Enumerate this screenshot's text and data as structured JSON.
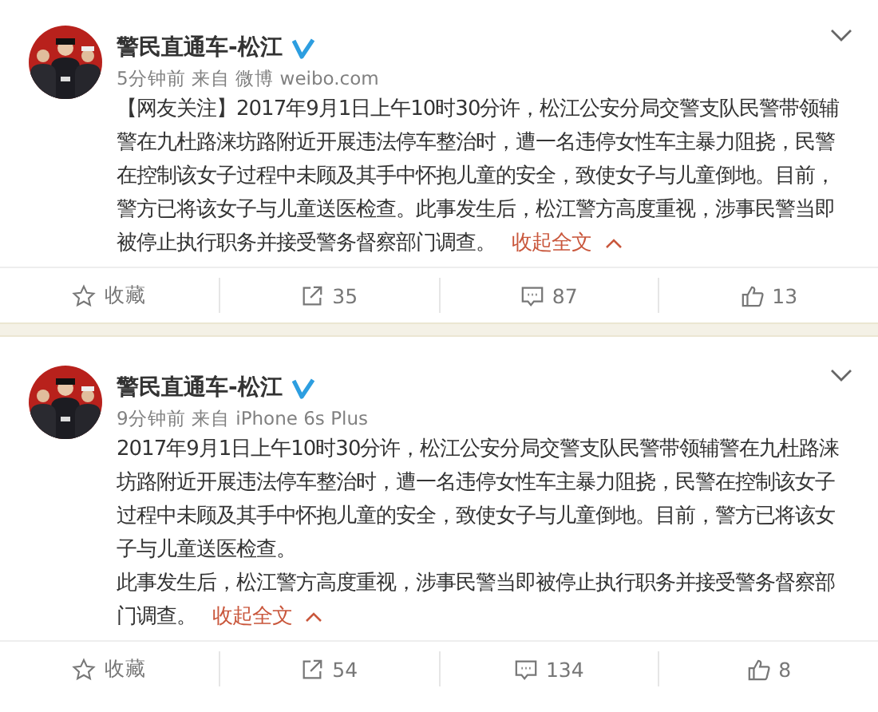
{
  "posts": [
    {
      "author": "警民直通车-松江",
      "verified": true,
      "meta": "5分钟前 来自 微博 weibo.com",
      "paragraphs": [
        "【网友关注】2017年9月1日上午10时30分许，松江公安分局交警支队民警带领辅警在九杜路涞坊路附近开展违法停车整治时，遭一名违停女性车主暴力阻挠，民警在控制该女子过程中未顾及其手中怀抱儿童的安全，致使女子与儿童倒地。目前，警方已将该女子与儿童送医检查。此事发生后，松江警方高度重视，涉事民警当即被停止执行职务并接受警务督察部门调查。"
      ],
      "collapse_link": "收起全文",
      "actions": [
        {
          "kind": "favorite",
          "label": "收藏"
        },
        {
          "kind": "repost",
          "label": "35"
        },
        {
          "kind": "comment",
          "label": "87"
        },
        {
          "kind": "like",
          "label": "13"
        }
      ]
    },
    {
      "author": "警民直通车-松江",
      "verified": true,
      "meta": "9分钟前 来自 iPhone 6s Plus",
      "paragraphs": [
        "2017年9月1日上午10时30分许，松江公安分局交警支队民警带领辅警在九杜路涞坊路附近开展违法停车整治时，遭一名违停女性车主暴力阻挠，民警在控制该女子过程中未顾及其手中怀抱儿童的安全，致使女子与儿童倒地。目前，警方已将该女子与儿童送医检查。",
        "此事发生后，松江警方高度重视，涉事民警当即被停止执行职务并接受警务督察部门调查。"
      ],
      "collapse_link": "收起全文",
      "actions": [
        {
          "kind": "favorite",
          "label": "收藏"
        },
        {
          "kind": "repost",
          "label": "54"
        },
        {
          "kind": "comment",
          "label": "134"
        },
        {
          "kind": "like",
          "label": "8"
        }
      ]
    }
  ]
}
